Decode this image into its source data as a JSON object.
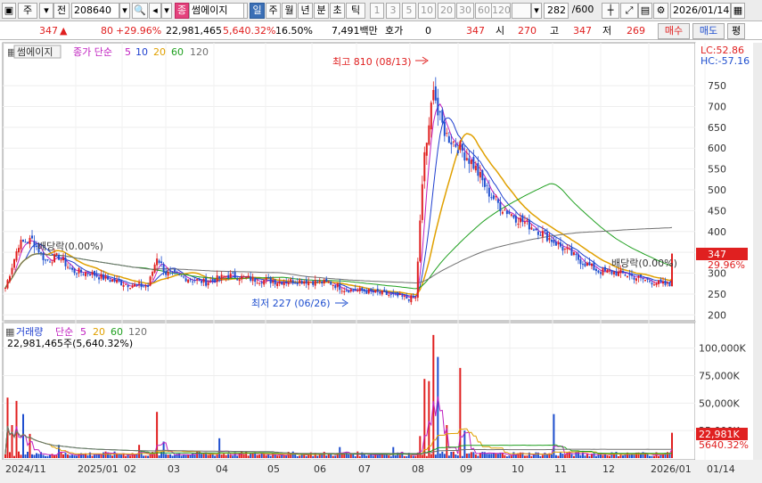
{
  "toolbar": {
    "market": "주",
    "market2": "전",
    "code": "208640",
    "name_badge": "종",
    "name": "썸에이지",
    "periods": [
      "일",
      "주",
      "월",
      "년",
      "분",
      "초",
      "틱"
    ],
    "active_period": "일",
    "intervals": [
      "1",
      "3",
      "5",
      "10",
      "20",
      "30",
      "60",
      "120"
    ],
    "count": "282",
    "total": "/600",
    "date": "2026/01/14"
  },
  "quote": {
    "price": "347",
    "change": "80",
    "change_pct": "+29.96%",
    "volume": "22,981,465",
    "volume_pct": "5,640.32%",
    "turnover": "16.50%",
    "amount": "7,491백만",
    "hoga_label": "호가",
    "hoga_value": "0",
    "hoga_price": "347",
    "open_label": "시",
    "open": "270",
    "high_label": "고",
    "high": "347",
    "low_label": "저",
    "low": "269",
    "buy_label": "매수",
    "sell_label": "매도",
    "flat_label": "평"
  },
  "colors": {
    "up": "#e02020",
    "down": "#1f4fcf",
    "ma5": "#c020c0",
    "ma10": "#1f3fcf",
    "ma20": "#e0a000",
    "ma60": "#20a020",
    "ma120": "#707070"
  },
  "chart_data": [
    {
      "type": "candlestick",
      "title": "썸에이지",
      "legend": [
        "종가 단순",
        "5",
        "10",
        "20",
        "60",
        "120"
      ],
      "lc": "LC:52.86",
      "hc": "HC:-57.16",
      "ylim": [
        190,
        840
      ],
      "yticks": [
        200,
        250,
        300,
        350,
        400,
        450,
        500,
        550,
        600,
        650,
        700,
        750
      ],
      "x_ticks": [
        "2024/11",
        "2025/01",
        "02",
        "03",
        "04",
        "05",
        "06",
        "07",
        "08",
        "09",
        "10",
        "11",
        "12",
        "2026/01",
        "01/14"
      ],
      "last_price": "347",
      "last_pct": "29.96%",
      "annotations": {
        "high": "최고 810 (08/13)",
        "low": "최저 227 (06/26)",
        "dividend1": "배당락(0.00%)",
        "dividend2": "배당락(0.00%)"
      },
      "anchors": [
        {
          "d": 0,
          "c": 265
        },
        {
          "d": 6,
          "c": 370
        },
        {
          "d": 12,
          "c": 380
        },
        {
          "d": 18,
          "c": 330
        },
        {
          "d": 24,
          "c": 340
        },
        {
          "d": 30,
          "c": 305
        },
        {
          "d": 38,
          "c": 300
        },
        {
          "d": 46,
          "c": 285
        },
        {
          "d": 56,
          "c": 272
        },
        {
          "d": 64,
          "c": 268
        },
        {
          "d": 68,
          "c": 340
        },
        {
          "d": 72,
          "c": 300
        },
        {
          "d": 80,
          "c": 290
        },
        {
          "d": 90,
          "c": 278
        },
        {
          "d": 100,
          "c": 295
        },
        {
          "d": 112,
          "c": 285
        },
        {
          "d": 122,
          "c": 280
        },
        {
          "d": 134,
          "c": 282
        },
        {
          "d": 146,
          "c": 276
        },
        {
          "d": 152,
          "c": 262
        },
        {
          "d": 160,
          "c": 258
        },
        {
          "d": 170,
          "c": 250
        },
        {
          "d": 180,
          "c": 240
        },
        {
          "d": 184,
          "c": 240
        },
        {
          "d": 186,
          "c": 420
        },
        {
          "d": 188,
          "c": 590
        },
        {
          "d": 190,
          "c": 640
        },
        {
          "d": 192,
          "c": 760
        },
        {
          "d": 194,
          "c": 680
        },
        {
          "d": 198,
          "c": 630
        },
        {
          "d": 204,
          "c": 600
        },
        {
          "d": 210,
          "c": 560
        },
        {
          "d": 216,
          "c": 500
        },
        {
          "d": 222,
          "c": 460
        },
        {
          "d": 230,
          "c": 430
        },
        {
          "d": 240,
          "c": 400
        },
        {
          "d": 250,
          "c": 360
        },
        {
          "d": 258,
          "c": 330
        },
        {
          "d": 266,
          "c": 305
        },
        {
          "d": 276,
          "c": 300
        },
        {
          "d": 286,
          "c": 285
        },
        {
          "d": 294,
          "c": 275
        },
        {
          "d": 298,
          "c": 270
        },
        {
          "d": 299,
          "c": 347
        }
      ]
    },
    {
      "type": "bar",
      "title": "거래량",
      "legend": [
        "단순",
        "5",
        "20",
        "60",
        "120"
      ],
      "value_label": "22,981,465주(5,640.32%)",
      "last_label": "22,981K",
      "last_pct": "5640.32%",
      "ylim": [
        0,
        120000
      ],
      "yticks": [
        [
          "100,000K",
          100000
        ],
        [
          "75,000K",
          75000
        ],
        [
          "50,000K",
          50000
        ],
        [
          "25,000K",
          25000
        ]
      ],
      "spikes": [
        {
          "d": 1,
          "v": 55000
        },
        {
          "d": 3,
          "v": 30000
        },
        {
          "d": 5,
          "v": 52000
        },
        {
          "d": 8,
          "v": 40000
        },
        {
          "d": 11,
          "v": 22000
        },
        {
          "d": 24,
          "v": 12000
        },
        {
          "d": 60,
          "v": 12000
        },
        {
          "d": 68,
          "v": 42000
        },
        {
          "d": 71,
          "v": 15000
        },
        {
          "d": 96,
          "v": 18000
        },
        {
          "d": 150,
          "v": 10000
        },
        {
          "d": 174,
          "v": 10000
        },
        {
          "d": 186,
          "v": 20000
        },
        {
          "d": 188,
          "v": 72000
        },
        {
          "d": 190,
          "v": 70000
        },
        {
          "d": 192,
          "v": 112000
        },
        {
          "d": 194,
          "v": 92000
        },
        {
          "d": 198,
          "v": 30000
        },
        {
          "d": 204,
          "v": 82000
        },
        {
          "d": 206,
          "v": 25000
        },
        {
          "d": 246,
          "v": 40000
        },
        {
          "d": 299,
          "v": 23000
        }
      ]
    }
  ]
}
